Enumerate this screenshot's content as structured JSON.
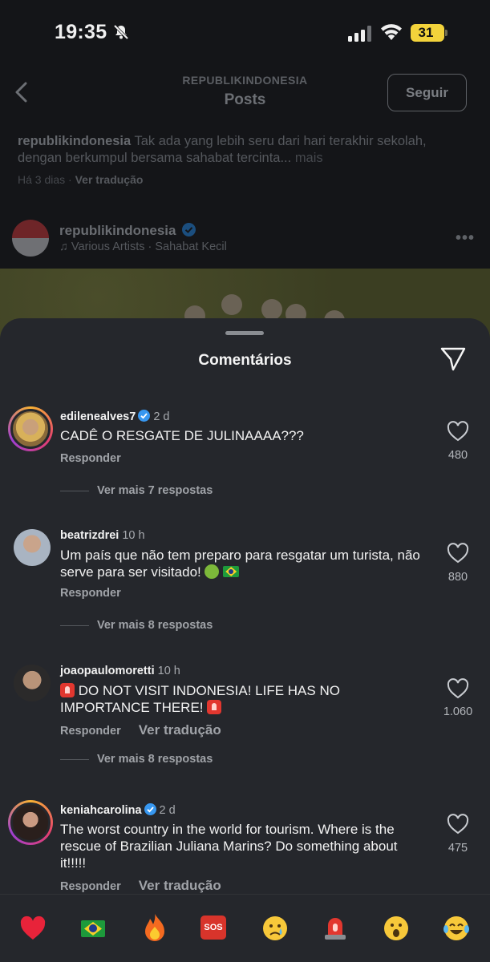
{
  "status_bar": {
    "time": "19:35",
    "battery": "31"
  },
  "nav": {
    "account": "REPUBLIKINDONESIA",
    "title": "Posts",
    "follow": "Seguir"
  },
  "caption": {
    "user": "republikindonesia",
    "text": "Tak ada yang lebih seru dari hari terakhir sekolah, dengan berkumpul bersama sahabat tercinta...",
    "more": "mais",
    "time": "Há 3 dias",
    "separator": "·",
    "translate": "Ver tradução"
  },
  "post": {
    "user": "republikindonesia",
    "audio": "Various Artists · Sahabat Kecil",
    "more": "•••"
  },
  "sheet": {
    "title": "Comentários"
  },
  "comments": [
    {
      "user": "edilenealves7",
      "verified": true,
      "time": "2 d",
      "text": "CADÊ O RESGATE DE JULINAAAA???",
      "reply": "Responder",
      "translate": "",
      "likes": "480",
      "replies": "Ver mais 7 respostas"
    },
    {
      "user": "beatrizdrei",
      "verified": false,
      "time": "10 h",
      "text": "Um país que não tem preparo para resgatar um turista, não serve para ser visitado!",
      "reply": "Responder",
      "translate": "",
      "likes": "880",
      "replies": "Ver mais 8 respostas"
    },
    {
      "user": "joaopaulomoretti",
      "verified": false,
      "time": "10 h",
      "text": "DO NOT VISIT INDONESIA! LIFE HAS NO IMPORTANCE THERE!",
      "reply": "Responder",
      "translate": "Ver tradução",
      "likes": "1.060",
      "replies": "Ver mais 8 respostas"
    },
    {
      "user": "keniahcarolina",
      "verified": true,
      "time": "2 d",
      "text": "The worst country in the world for tourism. Where is the rescue of Brazilian Juliana Marins? Do something about it!!!!!",
      "reply": "Responder",
      "translate": "Ver tradução",
      "likes": "475",
      "replies": ""
    }
  ],
  "emoji_bar": [
    "red-heart",
    "brazil-flag",
    "fire",
    "sos",
    "crying-face",
    "police-light",
    "astonished-face",
    "tears-of-joy"
  ],
  "emoji_sos_label": "SOS"
}
